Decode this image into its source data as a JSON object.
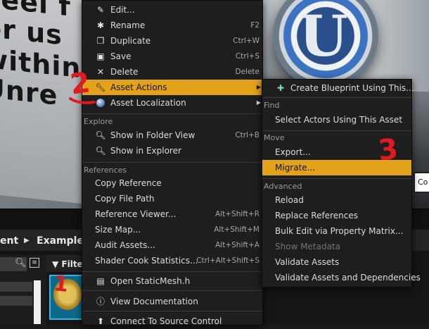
{
  "viewport": {
    "poster_lines": [
      "Feel f",
      "or us",
      "within",
      "Unre"
    ],
    "side_button": "Co"
  },
  "content_browser": {
    "breadcrumb": [
      "ent",
      "ExampleC"
    ],
    "filters_label": "Filter"
  },
  "context_menu": {
    "items_top": [
      {
        "label": "Edit...",
        "shortcut": "",
        "icon": "edit-icon"
      },
      {
        "label": "Rename",
        "shortcut": "F2",
        "icon": "rename-icon"
      },
      {
        "label": "Duplicate",
        "shortcut": "Ctrl+W",
        "icon": "duplicate-icon"
      },
      {
        "label": "Save",
        "shortcut": "Ctrl+S",
        "icon": "save-icon"
      },
      {
        "label": "Delete",
        "shortcut": "Delete",
        "icon": "delete-icon"
      },
      {
        "label": "Asset Actions",
        "shortcut": "",
        "icon": "wrench-icon"
      },
      {
        "label": "Asset Localization",
        "shortcut": "",
        "icon": "globe-icon"
      }
    ],
    "explore_header": "Explore",
    "explore_items": [
      {
        "label": "Show in Folder View",
        "shortcut": "Ctrl+B"
      },
      {
        "label": "Show in Explorer",
        "shortcut": ""
      }
    ],
    "references_header": "References",
    "reference_items": [
      {
        "label": "Copy Reference",
        "shortcut": ""
      },
      {
        "label": "Copy File Path",
        "shortcut": ""
      },
      {
        "label": "Reference Viewer...",
        "shortcut": "Alt+Shift+R"
      },
      {
        "label": "Size Map...",
        "shortcut": "Alt+Shift+M"
      },
      {
        "label": "Audit Assets...",
        "shortcut": "Alt+Shift+A"
      },
      {
        "label": "Shader Cook Statistics...",
        "shortcut": "Ctrl+Alt+Shift+S"
      }
    ],
    "bottom_items": [
      {
        "label": "Open StaticMesh.h"
      },
      {
        "label": "View Documentation"
      },
      {
        "label": "Connect To Source Control"
      }
    ]
  },
  "submenu": {
    "create_blueprint": "Create Blueprint Using This...",
    "find_header": "Find",
    "select_actors": "Select Actors Using This Asset",
    "move_header": "Move",
    "export": "Export...",
    "migrate": "Migrate...",
    "advanced_header": "Advanced",
    "advanced_items": [
      "Reload",
      "Replace References",
      "Bulk Edit via Property Matrix...",
      "Show Metadata",
      "Validate Assets",
      "Validate Assets and Dependencies"
    ]
  },
  "annotations": [
    "1",
    "2",
    "3"
  ],
  "colors": {
    "highlight": "#e2a21a",
    "annotation": "#e01a20",
    "menu_bg": "#1e1e1e"
  }
}
